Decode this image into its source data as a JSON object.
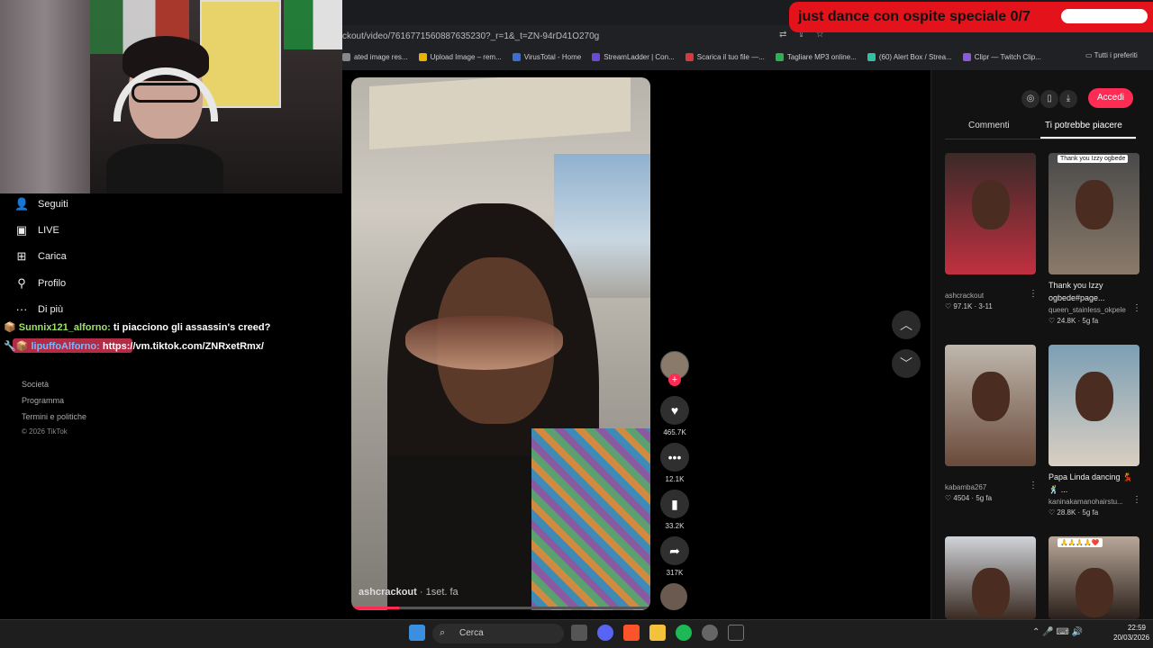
{
  "browser": {
    "url": "ckout/video/7616771560887635230?_r=1&_t=ZN-94rD41O270g",
    "bookmarks": [
      {
        "label": "ated image res...",
        "color": "#888"
      },
      {
        "label": "Upload Image – rem...",
        "color": "#e8b400"
      },
      {
        "label": "VirusTotal - Home",
        "color": "#3a6fd8"
      },
      {
        "label": "StreamLadder | Con...",
        "color": "#6b4bd6"
      },
      {
        "label": "Scarica il tuo file —...",
        "color": "#d83a3a"
      },
      {
        "label": "Tagliare MP3 online...",
        "color": "#2bb14d"
      },
      {
        "label": "(60) Alert Box / Strea...",
        "color": "#2ec2a0"
      },
      {
        "label": "Clipr — Twitch Clip...",
        "color": "#8a5bd8"
      }
    ],
    "all_bookmarks": "Tutti i preferiti"
  },
  "banner": {
    "text": "just dance con ospite speciale 0/7"
  },
  "sidebar": {
    "items": [
      {
        "label": "Seguiti",
        "icon": "following-icon"
      },
      {
        "label": "LIVE",
        "icon": "live-icon"
      },
      {
        "label": "Carica",
        "icon": "upload-icon"
      },
      {
        "label": "Profilo",
        "icon": "profile-icon"
      },
      {
        "label": "Di più",
        "icon": "more-icon"
      }
    ],
    "footer": [
      "Società",
      "Programma",
      "Termini e politiche",
      "© 2026 TikTok"
    ]
  },
  "chat": [
    {
      "user": "Sunnix121_alforno:",
      "msg": "ti piacciono gli assassin's creed?"
    },
    {
      "user": "lipuffoAlforno:",
      "msg": "https://vm.tiktok.com/ZNRxetRmx/"
    }
  ],
  "video": {
    "author": "ashcrackout",
    "date": "· 1set. fa",
    "progress": 0.16,
    "likes": "465.7K",
    "comments": "12.1K",
    "saves": "33.2K",
    "shares": "317K"
  },
  "panel": {
    "login": "Accedi",
    "tab_comments": "Commenti",
    "tab_suggested": "Ti potrebbe piacere",
    "thumbs": [
      {
        "caption": "",
        "author": "ashcrackout",
        "likes": "97.1K",
        "date": "3-11",
        "c1": "#3a2a28",
        "c2": "#c03040"
      },
      {
        "caption": "Thank you Izzy ogbede#page...",
        "author": "queen_stainless_okpele",
        "likes": "24.8K",
        "date": "5g fa",
        "c1": "#4a4a4a",
        "c2": "#8a7a6a",
        "overlay": "Thank you Izzy ogbede"
      },
      {
        "caption": "",
        "author": "kabamba267",
        "likes": "4504",
        "date": "5g fa",
        "c1": "#bfb7ad",
        "c2": "#6a4a3a"
      },
      {
        "caption": "Papa Linda dancing 💃 🕺 ...",
        "author": "kaninakamanohairstu...",
        "likes": "28.8K",
        "date": "5g fa",
        "c1": "#7c9fb4",
        "c2": "#d9cfc2"
      },
      {
        "caption": "",
        "author": "",
        "likes": "",
        "date": "",
        "c1": "#d0d4d8",
        "c2": "#3a2a22"
      },
      {
        "caption": "",
        "author": "",
        "likes": "",
        "date": "",
        "c1": "#b8a89a",
        "c2": "#2a1f1a",
        "overlay": "🙏🙏🙏🙏❤️"
      }
    ]
  },
  "taskbar": {
    "search": "Cerca",
    "time": "22:59",
    "date": "20/03/2026"
  }
}
